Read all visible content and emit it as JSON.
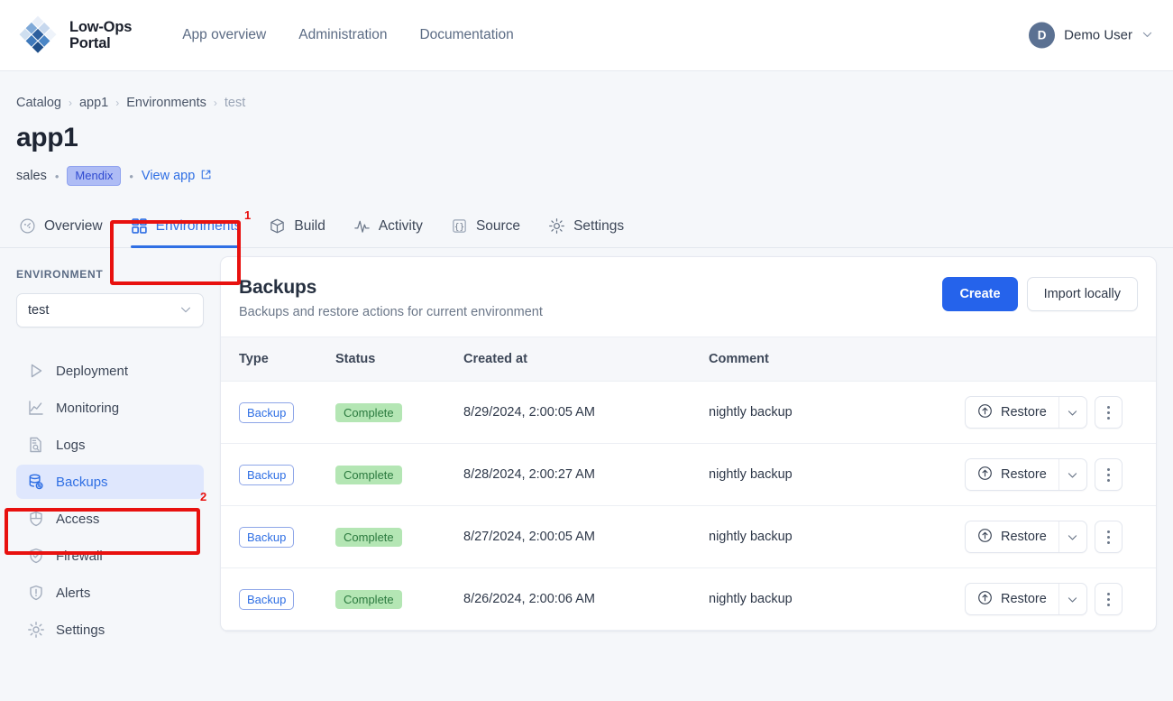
{
  "topbar": {
    "brand_name": "Low-Ops\nPortal",
    "logo_icon": "diamond-grid-logo",
    "nav": [
      {
        "label": "App overview"
      },
      {
        "label": "Administration"
      },
      {
        "label": "Documentation"
      }
    ],
    "user": {
      "avatar_initial": "D",
      "name": "Demo User",
      "caret_icon": "chevron-down-icon"
    }
  },
  "pagehead": {
    "breadcrumb": [
      {
        "label": "Catalog",
        "muted": false
      },
      {
        "label": "app1",
        "muted": false
      },
      {
        "label": "Environments",
        "muted": false
      },
      {
        "label": "test",
        "muted": true
      }
    ],
    "separator": "›",
    "title": "app1",
    "owner": "sales",
    "dot": "•",
    "platform_badge": "Mendix",
    "view_app_label": "View app",
    "view_app_icon": "external-link-icon"
  },
  "tabs": [
    {
      "label": "Overview",
      "icon": "gauge-icon",
      "active": false
    },
    {
      "label": "Environments",
      "icon": "grid-icon",
      "active": true
    },
    {
      "label": "Build",
      "icon": "box-icon",
      "active": false
    },
    {
      "label": "Activity",
      "icon": "pulse-icon",
      "active": false
    },
    {
      "label": "Source",
      "icon": "braces-icon",
      "active": false
    },
    {
      "label": "Settings",
      "icon": "gear-icon",
      "active": false
    }
  ],
  "sidebar": {
    "section_label": "ENVIRONMENT",
    "env_select": {
      "value": "test",
      "caret_icon": "chevron-down-icon"
    },
    "items": [
      {
        "label": "Deployment",
        "icon": "play-icon",
        "active": false
      },
      {
        "label": "Monitoring",
        "icon": "line-chart-icon",
        "active": false
      },
      {
        "label": "Logs",
        "icon": "document-search-icon",
        "active": false
      },
      {
        "label": "Backups",
        "icon": "database-sync-icon",
        "active": true
      },
      {
        "label": "Access",
        "icon": "shield-icon",
        "active": false
      },
      {
        "label": "Firewall",
        "icon": "shield-check-icon",
        "active": false
      },
      {
        "label": "Alerts",
        "icon": "shield-alert-icon",
        "active": false
      },
      {
        "label": "Settings",
        "icon": "gear-icon",
        "active": false
      }
    ]
  },
  "card": {
    "title": "Backups",
    "subtitle": "Backups and restore actions for current environment",
    "create_label": "Create",
    "import_label": "Import locally",
    "columns": [
      "Type",
      "Status",
      "Created at",
      "Comment",
      ""
    ],
    "row_action": {
      "restore_label": "Restore",
      "restore_icon": "arrow-up-circle-icon",
      "caret_icon": "chevron-down-icon",
      "kebab_icon": "kebab-menu-icon"
    },
    "rows": [
      {
        "type": "Backup",
        "status": "Complete",
        "created_at": "8/29/2024, 2:00:05 AM",
        "comment": "nightly backup"
      },
      {
        "type": "Backup",
        "status": "Complete",
        "created_at": "8/28/2024, 2:00:27 AM",
        "comment": "nightly backup"
      },
      {
        "type": "Backup",
        "status": "Complete",
        "created_at": "8/27/2024, 2:00:05 AM",
        "comment": "nightly backup"
      },
      {
        "type": "Backup",
        "status": "Complete",
        "created_at": "8/26/2024, 2:00:06 AM",
        "comment": "nightly backup"
      }
    ]
  },
  "annotations": [
    {
      "number": "1",
      "target": "environments-tab"
    },
    {
      "number": "2",
      "target": "sidebar-item-backups"
    }
  ],
  "colors": {
    "accent": "#2f6fe4",
    "primary_button": "#2563eb",
    "status_ok_bg": "#b4e6b4",
    "status_ok_text": "#2b7a3f",
    "annotation": "#e8110f",
    "page_bg": "#f5f7fa"
  }
}
